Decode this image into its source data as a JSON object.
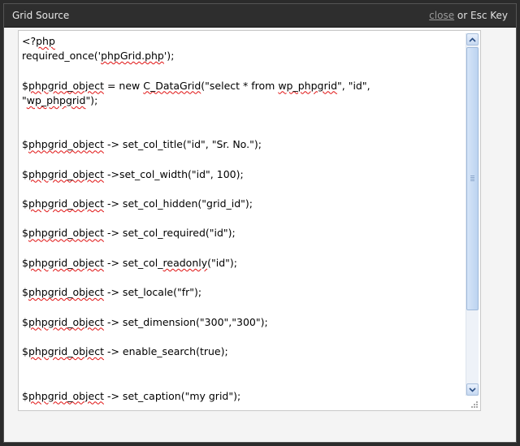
{
  "dialog": {
    "title": "Grid Source",
    "close_link": "close",
    "close_hint": " or Esc Key"
  },
  "code_lines": [
    [
      "<?",
      {
        "w": "php"
      }
    ],
    [
      "required_once('",
      {
        "w": "phpGrid.php"
      },
      "');"
    ],
    [
      ""
    ],
    [
      "$",
      {
        "w": "phpgrid_object"
      },
      " = new ",
      {
        "w": "C_DataGrid"
      },
      "(\"select * from ",
      {
        "w": "wp_phpgrid"
      },
      "\", \"id\","
    ],
    [
      "\"",
      {
        "w": "wp_phpgrid"
      },
      "\");"
    ],
    [
      ""
    ],
    [
      ""
    ],
    [
      "$",
      {
        "w": "phpgrid_object"
      },
      " -> set_col_title(\"id\", \"Sr. No.\");"
    ],
    [
      ""
    ],
    [
      "$",
      {
        "w": "phpgrid_object"
      },
      " ->set_col_width(\"id\", 100);"
    ],
    [
      ""
    ],
    [
      "$",
      {
        "w": "phpgrid_object"
      },
      " -> set_col_hidden(\"grid_id\");"
    ],
    [
      ""
    ],
    [
      "$",
      {
        "w": "phpgrid_object"
      },
      " -> set_col_required(\"id\");"
    ],
    [
      ""
    ],
    [
      "$",
      {
        "w": "phpgrid_object"
      },
      " -> set_col_",
      {
        "w": "readonly"
      },
      "(\"id\");"
    ],
    [
      ""
    ],
    [
      "$",
      {
        "w": "phpgrid_object"
      },
      " -> set_locale(\"fr\");"
    ],
    [
      ""
    ],
    [
      "$",
      {
        "w": "phpgrid_object"
      },
      " -> set_dimension(\"300\",\"300\");"
    ],
    [
      ""
    ],
    [
      "$",
      {
        "w": "phpgrid_object"
      },
      " -> enable_search(true);"
    ],
    [
      ""
    ],
    [
      ""
    ],
    [
      "$",
      {
        "w": "phpgrid_object"
      },
      " -> set_caption(\"my grid\");"
    ]
  ],
  "scrollbar": {
    "position_fraction": 0.0,
    "icons": {
      "up": "scroll-up-arrow-icon",
      "down": "scroll-down-arrow-icon",
      "grip": "scroll-thumb-grip-icon"
    }
  },
  "colors": {
    "titlebar": "#2e2e2e",
    "spellcheck_underline": "#e01010",
    "scrollbar_accent": "#bcd3f0"
  }
}
